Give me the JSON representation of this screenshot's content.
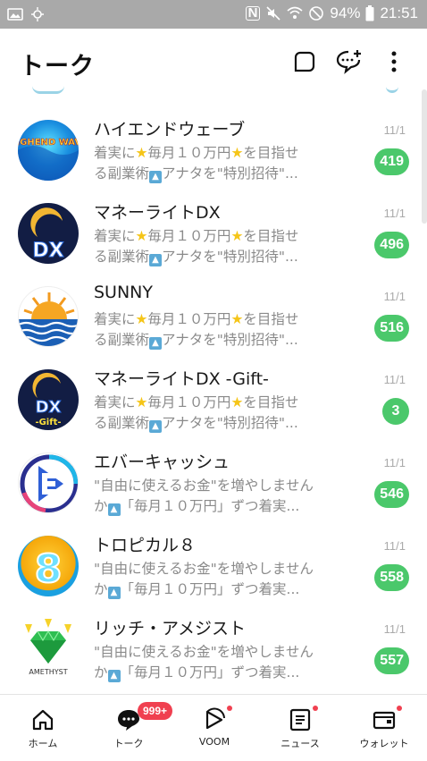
{
  "status_bar": {
    "battery": "94%",
    "time": "21:51"
  },
  "header": {
    "title": "トーク"
  },
  "chats": [
    {
      "name": "ハイエンドウェーブ",
      "preview_line1_a": "着実に",
      "preview_line1_b": "毎月１０万円",
      "preview_line1_c": "を目指せ",
      "preview_line2_a": "る副業術",
      "preview_line2_b": "アナタを\"特別招待\"...",
      "date": "11/1",
      "count": "419",
      "avatar_text": "HIGHEND WAVE"
    },
    {
      "name": "マネーライトDX",
      "preview_line1_a": "着実に",
      "preview_line1_b": "毎月１０万円",
      "preview_line1_c": "を目指せ",
      "preview_line2_a": "る副業術",
      "preview_line2_b": "アナタを\"特別招待\"...",
      "date": "11/1",
      "count": "496",
      "avatar_text": "DX"
    },
    {
      "name": "SUNNY",
      "preview_line1_a": "着実に",
      "preview_line1_b": "毎月１０万円",
      "preview_line1_c": "を目指せ",
      "preview_line2_a": "る副業術",
      "preview_line2_b": "アナタを\"特別招待\"...",
      "date": "11/1",
      "count": "516"
    },
    {
      "name": "マネーライトDX -Gift-",
      "preview_line1_a": "着実に",
      "preview_line1_b": "毎月１０万円",
      "preview_line1_c": "を目指せ",
      "preview_line2_a": "る副業術",
      "preview_line2_b": "アナタを\"特別招待\"...",
      "date": "11/1",
      "count": "3",
      "avatar_text": "DX",
      "avatar_subtext": "-Gift-"
    },
    {
      "name": "エバーキャッシュ",
      "preview_line1": "\"自由に使えるお金\"を増やしません",
      "preview_line2_a": "か",
      "preview_line2_b": "「毎月１０万円」ずつ着実...",
      "date": "11/1",
      "count": "546"
    },
    {
      "name": "トロピカル８",
      "preview_line1": "\"自由に使えるお金\"を増やしません",
      "preview_line2_a": "か",
      "preview_line2_b": "「毎月１０万円」ずつ着実...",
      "date": "11/1",
      "count": "558",
      "avatar_text": "8"
    },
    {
      "name": "リッチ・アメジスト",
      "preview_line1": "\"自由に使えるお金\"を増やしません",
      "preview_line2_a": "か",
      "preview_line2_b": "「毎月１０万円」ずつ着実...",
      "date": "11/1",
      "count": "557",
      "avatar_text": "AMETHYST"
    }
  ],
  "nav": {
    "home": "ホーム",
    "talk": "トーク",
    "talk_badge": "999+",
    "voom": "VOOM",
    "news": "ニュース",
    "wallet": "ウォレット"
  },
  "colors": {
    "badge_green": "#4bc86b",
    "badge_red": "#f04050",
    "status_bar": "#a9a9a9"
  }
}
